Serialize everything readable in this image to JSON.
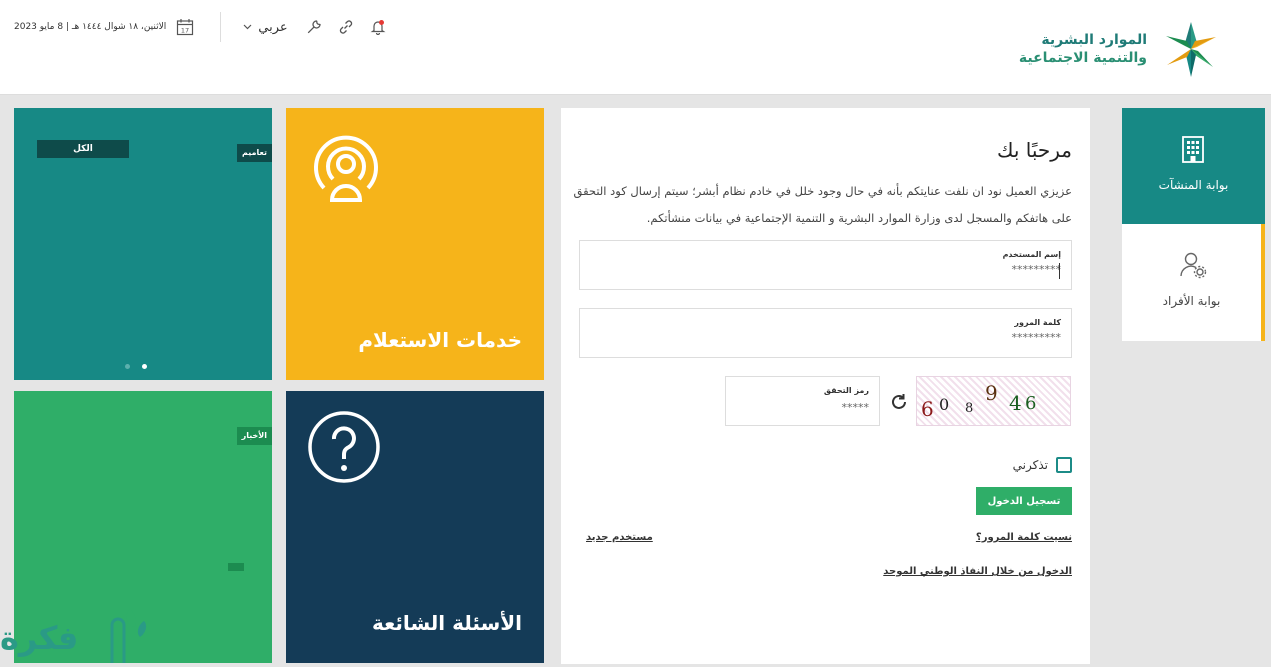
{
  "header": {
    "logo_line1": "الموارد البشرية",
    "logo_line2": "والتنمية الاجتماعية",
    "date": "الاثنين، ١٨ شوال ١٤٤٤ هـ | 8 مايو 2023",
    "calendar_day": "17",
    "language": "عربي",
    "icons": [
      "calendar-icon",
      "chevron-down-icon",
      "wrench-icon",
      "link-icon",
      "bell-icon"
    ]
  },
  "tiles": {
    "all_tab": "الكل",
    "circulars_tag": "تعاميم",
    "news_tag": "الأخبار",
    "inquiry_title": "خدمات الاستعلام",
    "faq_title": "الأسئلة الشائعة"
  },
  "login": {
    "welcome": "مرحبًا بك",
    "intro": "عزيزي العميل نود ان نلفت عنايتكم بأنه في حال وجود خلل في خادم نظام أبشر؛ سيتم إرسال كود التحقق على هاتفكم والمسجل لدى وزارة الموارد البشرية و التنمية الإجتماعية في بيانات منشأتكم.",
    "username_label": "إسم المستخدم",
    "username_value": "*********",
    "password_label": "كلمة المرور",
    "password_value": "*********",
    "captcha_label": "رمز التحقق",
    "captcha_value": "*****",
    "captcha_chars": [
      "6",
      "0",
      "8",
      "9",
      "4",
      "6"
    ],
    "remember": "تذكرني",
    "submit": "تسجيل الدخول",
    "forgot": "نسيت كلمة المرور؟",
    "new_user": "مستخدم جديد",
    "nafath": "الدخول من خلال النفاذ الوطني الموحد"
  },
  "portals": {
    "establishments": "بوابة المنشآت",
    "individuals": "بوابة الأفراد"
  },
  "watermark": "فكرة",
  "colors": {
    "teal": "#178985",
    "yellow": "#f6b41a",
    "green": "#2fae68",
    "navy": "#143b57"
  }
}
